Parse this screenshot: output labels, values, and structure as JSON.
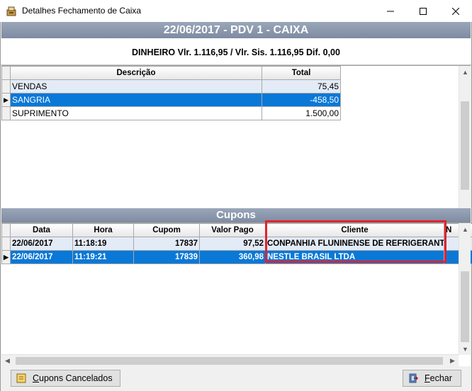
{
  "window": {
    "title": "Detalhes Fechamento de Caixa"
  },
  "header": {
    "title": "22/06/2017 - PDV 1 - CAIXA"
  },
  "summary": {
    "text": "DINHEIRO Vlr. 1.116,95 / Vlr. Sis. 1.116,95 Dif. 0,00"
  },
  "grid1": {
    "columns": [
      "Descrição",
      "Total"
    ],
    "rows": [
      {
        "descricao": "VENDAS",
        "total": "75,45"
      },
      {
        "descricao": "SANGRIA",
        "total": "-458,50"
      },
      {
        "descricao": "SUPRIMENTO",
        "total": "1.500,00"
      }
    ]
  },
  "cupons": {
    "title": "Cupons",
    "columns": [
      "Data",
      "Hora",
      "Cupom",
      "Valor Pago",
      "Cliente",
      "N"
    ],
    "rows": [
      {
        "data": "22/06/2017",
        "hora": "11:18:19",
        "cupom": "17837",
        "valor": "97,52",
        "cliente": "CONPANHIA FLUNINENSE DE REFRIGERANTE"
      },
      {
        "data": "22/06/2017",
        "hora": "11:19:21",
        "cupom": "17839",
        "valor": "360,98",
        "cliente": "NESTLE BRASIL LTDA"
      }
    ]
  },
  "buttons": {
    "cancelados_prefix": "C",
    "cancelados_rest": "upons Cancelados",
    "fechar_prefix": "F",
    "fechar_rest": "echar"
  },
  "colors": {
    "selection": "#0a78d7",
    "header_bar": "#8a96ab",
    "highlight": "#e0232e"
  }
}
